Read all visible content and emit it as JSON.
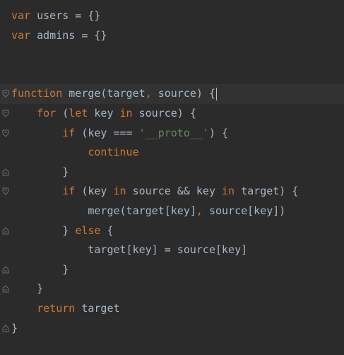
{
  "editor": {
    "lines": [
      {
        "tokens": [
          {
            "t": "var",
            "k": "kw"
          },
          {
            "t": " users = {}",
            "k": "txt"
          }
        ]
      },
      {
        "tokens": [
          {
            "t": "var",
            "k": "kw"
          },
          {
            "t": " admins = {}",
            "k": "txt"
          }
        ]
      },
      {
        "tokens": []
      },
      {
        "tokens": []
      },
      {
        "tokens": [
          {
            "t": "function",
            "k": "kw"
          },
          {
            "t": " merge(target",
            "k": "txt"
          },
          {
            "t": ",",
            "k": "kw"
          },
          {
            "t": " source) ",
            "k": "txt"
          },
          {
            "t": "{",
            "k": "txt"
          }
        ],
        "current": true
      },
      {
        "tokens": [
          {
            "t": "    ",
            "k": "txt"
          },
          {
            "t": "for",
            "k": "kw"
          },
          {
            "t": " (",
            "k": "txt"
          },
          {
            "t": "let",
            "k": "kw"
          },
          {
            "t": " key ",
            "k": "txt"
          },
          {
            "t": "in",
            "k": "kw"
          },
          {
            "t": " source) {",
            "k": "txt"
          }
        ]
      },
      {
        "tokens": [
          {
            "t": "        ",
            "k": "txt"
          },
          {
            "t": "if",
            "k": "kw"
          },
          {
            "t": " (key === ",
            "k": "txt"
          },
          {
            "t": "'__proto__'",
            "k": "str"
          },
          {
            "t": ") {",
            "k": "txt"
          }
        ]
      },
      {
        "tokens": [
          {
            "t": "            ",
            "k": "txt"
          },
          {
            "t": "continue",
            "k": "kw"
          }
        ]
      },
      {
        "tokens": [
          {
            "t": "        }",
            "k": "txt"
          }
        ]
      },
      {
        "tokens": [
          {
            "t": "        ",
            "k": "txt"
          },
          {
            "t": "if",
            "k": "kw"
          },
          {
            "t": " (key ",
            "k": "txt"
          },
          {
            "t": "in",
            "k": "kw"
          },
          {
            "t": " source && key ",
            "k": "txt"
          },
          {
            "t": "in",
            "k": "kw"
          },
          {
            "t": " target) {",
            "k": "txt"
          }
        ]
      },
      {
        "tokens": [
          {
            "t": "            merge(target[key]",
            "k": "txt"
          },
          {
            "t": ",",
            "k": "kw"
          },
          {
            "t": " source[key])",
            "k": "txt"
          }
        ]
      },
      {
        "tokens": [
          {
            "t": "        } ",
            "k": "txt"
          },
          {
            "t": "else",
            "k": "kw"
          },
          {
            "t": " {",
            "k": "txt"
          }
        ]
      },
      {
        "tokens": [
          {
            "t": "            target[key] = source[key]",
            "k": "txt"
          }
        ]
      },
      {
        "tokens": [
          {
            "t": "        }",
            "k": "txt"
          }
        ]
      },
      {
        "tokens": [
          {
            "t": "    }",
            "k": "txt"
          }
        ]
      },
      {
        "tokens": [
          {
            "t": "    ",
            "k": "txt"
          },
          {
            "t": "return",
            "k": "kw"
          },
          {
            "t": " target",
            "k": "txt"
          }
        ]
      },
      {
        "tokens": [
          {
            "t": "}",
            "k": "txt"
          }
        ]
      }
    ],
    "fold_markers": [
      {
        "line": 4,
        "icon": "fold-open-icon"
      },
      {
        "line": 5,
        "icon": "fold-open-icon"
      },
      {
        "line": 6,
        "icon": "fold-open-icon"
      },
      {
        "line": 8,
        "icon": "fold-close-icon"
      },
      {
        "line": 9,
        "icon": "fold-open-icon"
      },
      {
        "line": 11,
        "icon": "fold-close-icon"
      },
      {
        "line": 13,
        "icon": "fold-close-icon"
      },
      {
        "line": 14,
        "icon": "fold-close-icon"
      },
      {
        "line": 16,
        "icon": "fold-close-icon"
      }
    ],
    "colors": {
      "background": "#2b2b2b",
      "keyword": "#cc7832",
      "string": "#6a8759",
      "text": "#a9b7c6",
      "current_line": "#323232"
    }
  }
}
